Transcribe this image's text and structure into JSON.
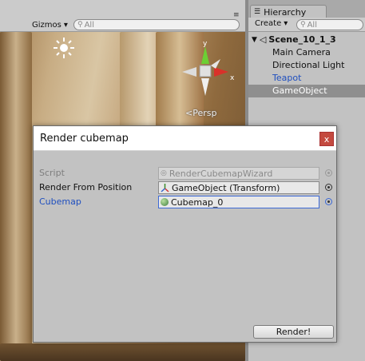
{
  "scene_view": {
    "gizmos_label": "Gizmos",
    "search_placeholder": "All",
    "projection_label": "Persp",
    "gizmo_axes": {
      "y": "y",
      "x": "x"
    }
  },
  "hierarchy": {
    "tab_label": "Hierarchy",
    "create_label": "Create",
    "search_placeholder": "All",
    "scene_name": "Scene_10_1_3",
    "items": [
      {
        "label": "Main Camera",
        "style": "normal"
      },
      {
        "label": "Directional Light",
        "style": "normal"
      },
      {
        "label": "Teapot",
        "style": "blue"
      },
      {
        "label": "GameObject",
        "style": "selected"
      }
    ]
  },
  "dialog": {
    "title": "Render cubemap",
    "close_label": "x",
    "fields": [
      {
        "label": "Script",
        "value": "RenderCubemapWizard",
        "state": "disabled"
      },
      {
        "label": "Render From Position",
        "value": "GameObject (Transform)",
        "state": "normal"
      },
      {
        "label": "Cubemap",
        "value": "Cubemap_0",
        "state": "focused"
      }
    ],
    "render_button": "Render!"
  },
  "colors": {
    "selected_row": "#8f8f8f",
    "prefab_blue": "#1f4fbf",
    "close_red": "#c44a3f",
    "focus_border": "#3d6ad6"
  }
}
